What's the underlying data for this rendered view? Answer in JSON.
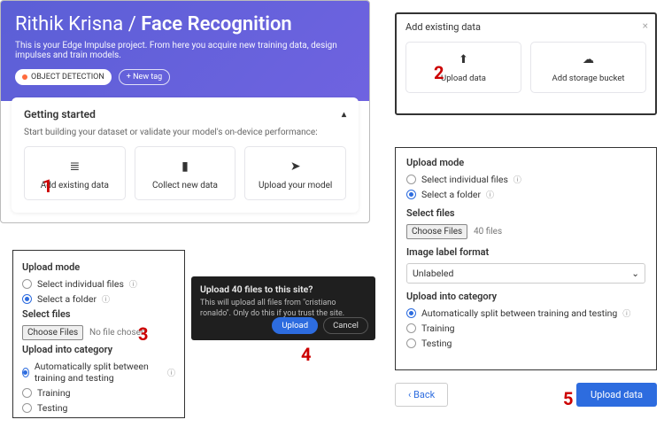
{
  "panel1": {
    "owner": "Rithik Krisna",
    "separator": "/",
    "project": "Face Recognition",
    "subtitle": "This is your Edge Impulse project. From here you acquire new training data, design impulses and train models.",
    "badge": "OBJECT DETECTION",
    "new_tag": "+  New tag",
    "card_title": "Getting started",
    "card_sub": "Start building your dataset or validate your model's on-device performance:",
    "tiles": [
      {
        "icon": "≣",
        "label": "Add existing data"
      },
      {
        "icon": "▮",
        "label": "Collect new data"
      },
      {
        "icon": "➤",
        "label": "Upload your model"
      }
    ]
  },
  "panel2": {
    "title": "Add existing data",
    "tiles": [
      {
        "icon": "⬆",
        "label": "Upload data"
      },
      {
        "icon": "☁",
        "label": "Add storage bucket"
      }
    ]
  },
  "panel3": {
    "upload_mode_hdr": "Upload mode",
    "opt_individual": "Select individual files",
    "opt_folder": "Select a folder",
    "select_files_hdr": "Select files",
    "choose_files": "Choose Files",
    "choose_hint": "No file chosen",
    "category_hdr": "Upload into category",
    "opt_auto": "Automatically split between training and testing",
    "opt_training": "Training",
    "opt_testing": "Testing"
  },
  "panel4": {
    "title": "Upload 40 files to this site?",
    "body": "This will upload all files from \"cristiano ronaldo\". Only do this if you trust the site.",
    "upload": "Upload",
    "cancel": "Cancel"
  },
  "panel5": {
    "upload_mode_hdr": "Upload mode",
    "opt_individual": "Select individual files",
    "opt_folder": "Select a folder",
    "select_files_hdr": "Select files",
    "choose_files": "Choose Files",
    "choose_hint": "40 files",
    "label_hdr": "Image label format",
    "label_value": "Unlabeled",
    "category_hdr": "Upload into category",
    "opt_auto": "Automatically split between training and testing",
    "opt_training": "Training",
    "opt_testing": "Testing",
    "back": "‹   Back",
    "upload": "Upload data"
  },
  "steps": {
    "s1": "1",
    "s2": "2",
    "s3": "3",
    "s4": "4",
    "s5": "5"
  }
}
